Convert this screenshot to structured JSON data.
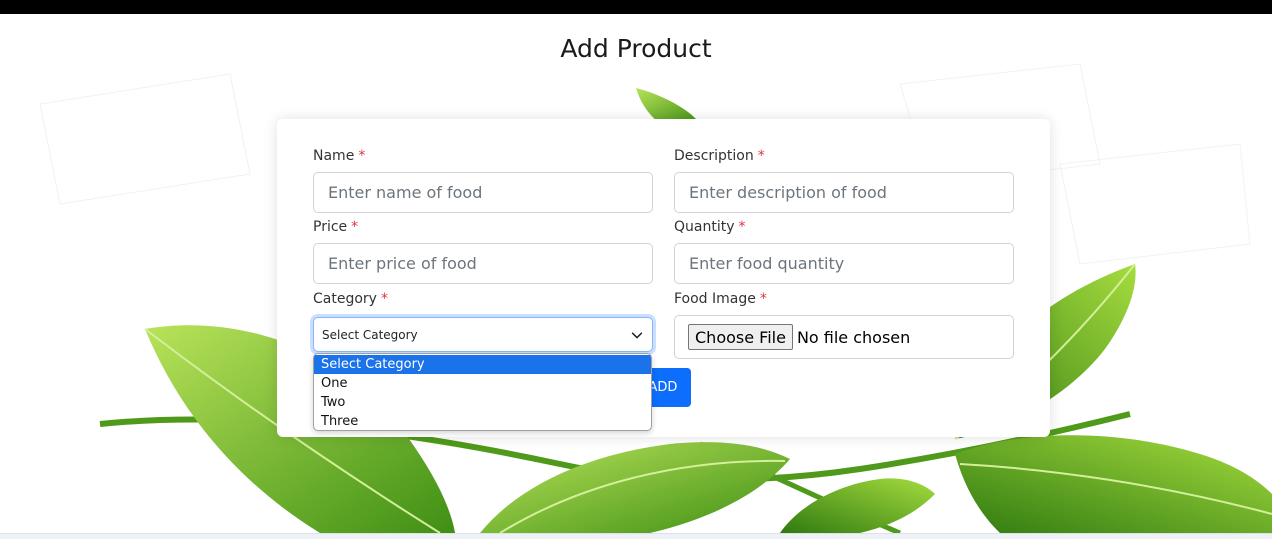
{
  "page": {
    "title": "Add Product"
  },
  "form": {
    "name": {
      "label": "Name",
      "required_mark": "*",
      "placeholder": "Enter name of food"
    },
    "description": {
      "label": "Description",
      "required_mark": "*",
      "placeholder": "Enter description of food"
    },
    "price": {
      "label": "Price",
      "required_mark": "*",
      "placeholder": "Enter price of food"
    },
    "quantity": {
      "label": "Quantity",
      "required_mark": "*",
      "placeholder": "Enter food quantity"
    },
    "category": {
      "label": "Category",
      "required_mark": "*",
      "selected": "Select Category",
      "options": [
        "Select Category",
        "One",
        "Two",
        "Three"
      ],
      "highlighted_option": "Select Category"
    },
    "food_image": {
      "label": "Food Image",
      "required_mark": "*",
      "button_label": "Choose File",
      "status": "No file chosen"
    },
    "submit_label": "ADD"
  },
  "colors": {
    "primary": "#0d6efd",
    "required": "#dc3545",
    "option_highlight": "#1a73e8",
    "leaf_light": "#8ccf2e",
    "leaf_dark": "#3f8f14"
  }
}
